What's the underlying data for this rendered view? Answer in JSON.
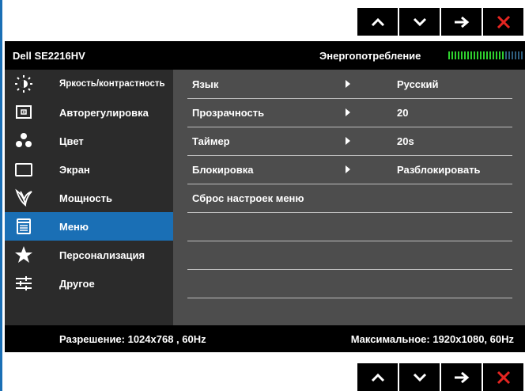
{
  "header": {
    "model": "Dell SE2216HV",
    "energy_label": "Энергопотребление",
    "energy_level": 0.75,
    "colors": {
      "active": "#2fd12f",
      "inactive": "#2f5f7f"
    }
  },
  "menu": {
    "active_index": 5,
    "accent": "#1a6fb5",
    "items": [
      {
        "label": "Яркость/контрастность",
        "icon": "brightness-icon"
      },
      {
        "label": "Авторегулировка",
        "icon": "auto-adjust-icon"
      },
      {
        "label": "Цвет",
        "icon": "color-icon"
      },
      {
        "label": "Экран",
        "icon": "display-icon"
      },
      {
        "label": "Мощность",
        "icon": "power-icon"
      },
      {
        "label": "Меню",
        "icon": "menu-icon"
      },
      {
        "label": "Персонализация",
        "icon": "star-icon"
      },
      {
        "label": "Другое",
        "icon": "sliders-icon"
      }
    ]
  },
  "settings": [
    {
      "label": "Язык",
      "value": "Русский"
    },
    {
      "label": "Прозрачность",
      "value": "20"
    },
    {
      "label": "Таймер",
      "value": "20s"
    },
    {
      "label": "Блокировка",
      "value": "Разблокировать"
    },
    {
      "label": "Сброс настроек меню",
      "value": ""
    }
  ],
  "footer": {
    "resolution": "Разрешение: 1024x768 , 60Hz",
    "max": "Максимальное: 1920x1080, 60Hz"
  },
  "buttons": [
    {
      "name": "up-button",
      "icon": "chevron-up-icon"
    },
    {
      "name": "down-button",
      "icon": "chevron-down-icon"
    },
    {
      "name": "enter-button",
      "icon": "arrow-right-icon"
    },
    {
      "name": "exit-button",
      "icon": "close-icon"
    }
  ]
}
